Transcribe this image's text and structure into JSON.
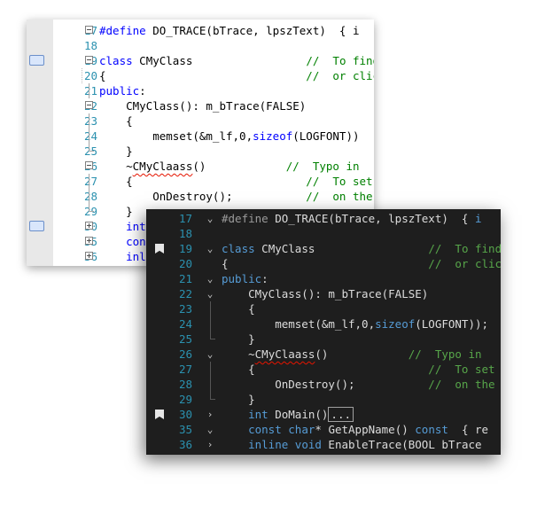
{
  "light_editor": {
    "lines": [
      {
        "num": "17",
        "parts": [
          {
            "t": "#define",
            "c": "pp"
          },
          {
            "t": " DO_TRACE(bTrace, lpszText)  { i"
          }
        ]
      },
      {
        "num": "18",
        "parts": []
      },
      {
        "num": "19",
        "parts": [
          {
            "t": "class",
            "c": "kw"
          },
          {
            "t": " CMyClass                 "
          },
          {
            "t": "//  To find",
            "c": "cm"
          }
        ]
      },
      {
        "num": "20",
        "parts": [
          {
            "t": "{                              "
          },
          {
            "t": "//  or clic",
            "c": "cm"
          }
        ]
      },
      {
        "num": "21",
        "parts": [
          {
            "t": "public",
            "c": "kw"
          },
          {
            "t": ":"
          }
        ]
      },
      {
        "num": "22",
        "parts": [
          {
            "t": "    CMyClass(): m_bTrace(FALSE)"
          }
        ]
      },
      {
        "num": "23",
        "parts": [
          {
            "t": "    {"
          }
        ]
      },
      {
        "num": "24",
        "parts": [
          {
            "t": "        memset(&m_lf,0,"
          },
          {
            "t": "sizeof",
            "c": "kw"
          },
          {
            "t": "(LOGFONT))"
          }
        ]
      },
      {
        "num": "25",
        "parts": [
          {
            "t": "    }"
          }
        ]
      },
      {
        "num": "26",
        "parts": [
          {
            "t": "    ~"
          },
          {
            "t": "CMyClaass",
            "c": "squig"
          },
          {
            "t": "()            "
          },
          {
            "t": "//  Typo in",
            "c": "cm"
          }
        ]
      },
      {
        "num": "27",
        "parts": [
          {
            "t": "    {                          "
          },
          {
            "t": "//  To set",
            "c": "cm"
          }
        ]
      },
      {
        "num": "28",
        "parts": [
          {
            "t": "        OnDestroy();           "
          },
          {
            "t": "//  on the",
            "c": "cm"
          }
        ]
      },
      {
        "num": "29",
        "parts": [
          {
            "t": "    }"
          }
        ]
      },
      {
        "num": "30",
        "parts": [
          {
            "t": "    "
          },
          {
            "t": "int",
            "c": "kw"
          }
        ]
      },
      {
        "num": "35",
        "parts": [
          {
            "t": "    "
          },
          {
            "t": "con",
            "c": "kw"
          }
        ]
      },
      {
        "num": "36",
        "parts": [
          {
            "t": "    "
          },
          {
            "t": "inl",
            "c": "kw"
          }
        ]
      }
    ]
  },
  "dark_editor": {
    "lines": [
      {
        "num": "17",
        "parts": [
          {
            "t": "#define",
            "c": "pp"
          },
          {
            "t": " DO_TRACE(bTrace, lpszText)  { "
          },
          {
            "t": "i",
            "c": "kw"
          }
        ]
      },
      {
        "num": "18",
        "parts": []
      },
      {
        "num": "19",
        "parts": [
          {
            "t": "class",
            "c": "kw"
          },
          {
            "t": " CMyClass                 "
          },
          {
            "t": "//  To find",
            "c": "cm"
          }
        ]
      },
      {
        "num": "20",
        "parts": [
          {
            "t": "{                              "
          },
          {
            "t": "//  or click",
            "c": "cm"
          }
        ]
      },
      {
        "num": "21",
        "parts": [
          {
            "t": "public",
            "c": "kw"
          },
          {
            "t": ":"
          }
        ]
      },
      {
        "num": "22",
        "parts": [
          {
            "t": "    CMyClass(): m_bTrace(FALSE)"
          }
        ]
      },
      {
        "num": "23",
        "parts": [
          {
            "t": "    {"
          }
        ]
      },
      {
        "num": "24",
        "parts": [
          {
            "t": "        memset(&m_lf,0,"
          },
          {
            "t": "sizeof",
            "c": "kw"
          },
          {
            "t": "(LOGFONT));"
          }
        ]
      },
      {
        "num": "25",
        "parts": [
          {
            "t": "    }"
          }
        ]
      },
      {
        "num": "26",
        "parts": [
          {
            "t": "    ~"
          },
          {
            "t": "CMyClaass",
            "c": "squig"
          },
          {
            "t": "()            "
          },
          {
            "t": "//  Typo in",
            "c": "cm"
          }
        ]
      },
      {
        "num": "27",
        "parts": [
          {
            "t": "    {                          "
          },
          {
            "t": "//  To set c",
            "c": "cm"
          }
        ]
      },
      {
        "num": "28",
        "parts": [
          {
            "t": "        OnDestroy();           "
          },
          {
            "t": "//  on the F",
            "c": "cm"
          }
        ]
      },
      {
        "num": "29",
        "parts": [
          {
            "t": "    }"
          }
        ]
      },
      {
        "num": "30",
        "parts": [
          {
            "t": "    "
          },
          {
            "t": "int",
            "c": "kw"
          },
          {
            "t": " DoMain()"
          },
          {
            "t": "...",
            "c": "ellipsis"
          }
        ]
      },
      {
        "num": "35",
        "parts": [
          {
            "t": "    "
          },
          {
            "t": "const",
            "c": "kw"
          },
          {
            "t": " "
          },
          {
            "t": "char",
            "c": "kw"
          },
          {
            "t": "* GetAppName() "
          },
          {
            "t": "const",
            "c": "kw"
          },
          {
            "t": "  { re"
          }
        ]
      },
      {
        "num": "36",
        "parts": [
          {
            "t": "    "
          },
          {
            "t": "inline",
            "c": "kw"
          },
          {
            "t": " "
          },
          {
            "t": "void",
            "c": "kw"
          },
          {
            "t": " EnableTrace(BOOL bTrace"
          }
        ]
      }
    ]
  },
  "colors": {
    "light_background": "#ffffff",
    "dark_background": "#1e1e1e",
    "line_number": "#2b91af",
    "light_keyword": "#0000ff",
    "light_comment": "#008000",
    "dark_keyword": "#569cd6",
    "dark_comment": "#57a64a",
    "error_squiggle": "#e51400"
  }
}
